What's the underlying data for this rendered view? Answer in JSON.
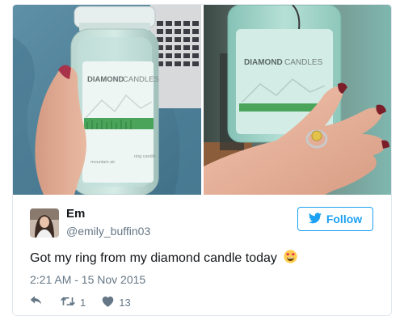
{
  "photos": {
    "left": {
      "brand_bold": "DIAMOND",
      "brand_light": "CANDLES",
      "fine_print_left": "mountain air",
      "fine_print_right": "ring candle"
    },
    "right": {
      "brand_bold": "DIAMOND",
      "brand_light": "CANDLES"
    }
  },
  "user": {
    "name": "Em",
    "handle": "@emily_buffin03"
  },
  "follow_button": {
    "label": "Follow",
    "icon": "twitter-bird-icon"
  },
  "tweet": {
    "text": "Got my ring from my diamond candle today",
    "emoji_name": "heart-eyes-emoji",
    "timestamp": "2:21 AM - 15 Nov 2015"
  },
  "actions": {
    "reply_icon": "reply-icon",
    "retweet_icon": "retweet-icon",
    "retweet_count": "1",
    "like_icon": "heart-icon",
    "like_count": "13"
  },
  "colors": {
    "twitter_blue": "#1da1f2",
    "text_primary": "#14171a",
    "text_secondary": "#657786",
    "border": "#e1e8ed"
  }
}
